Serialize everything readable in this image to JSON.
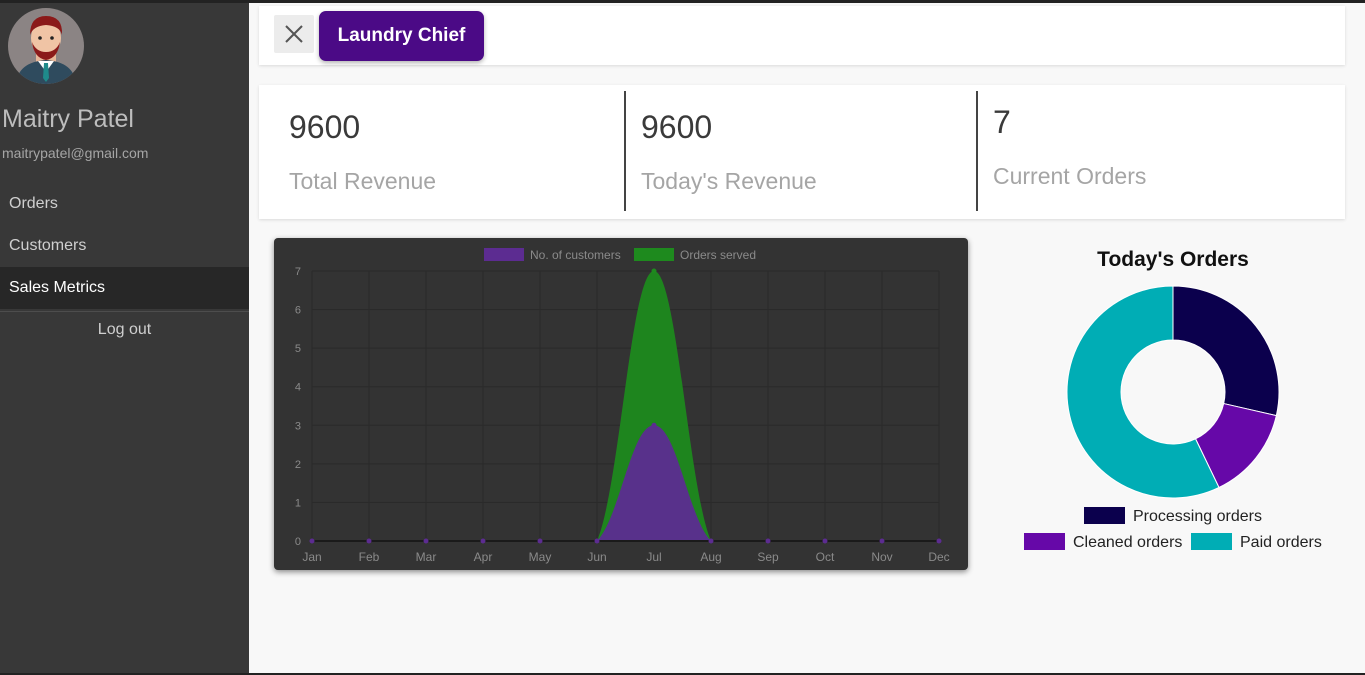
{
  "user": {
    "name": "Maitry Patel",
    "email": "maitrypatel@gmail.com"
  },
  "sidebar": {
    "items": [
      {
        "label": "Orders"
      },
      {
        "label": "Customers"
      },
      {
        "label": "Sales Metrics"
      }
    ],
    "logout_label": "Log out"
  },
  "topbar": {
    "brand_label": "Laundry Chief",
    "close_icon": "close-icon"
  },
  "stats": [
    {
      "value": "9600",
      "label": "Total Revenue"
    },
    {
      "value": "9600",
      "label": "Today's Revenue"
    },
    {
      "value": "7",
      "label": "Current Orders"
    }
  ],
  "colors": {
    "brand": "#4b0a86",
    "customers": "#5c2c91",
    "orders": "#1e8a1e",
    "processing": "#0b004d",
    "cleaned": "#6608a8",
    "paid": "#00adb5"
  },
  "chart_data": [
    {
      "type": "area",
      "categories": [
        "Jan",
        "Feb",
        "Mar",
        "Apr",
        "May",
        "Jun",
        "Jul",
        "Aug",
        "Sep",
        "Oct",
        "Nov",
        "Dec"
      ],
      "series": [
        {
          "name": "No. of customers",
          "values": [
            0,
            0,
            0,
            0,
            0,
            0,
            3,
            0,
            0,
            0,
            0,
            0
          ]
        },
        {
          "name": "Orders served",
          "values": [
            0,
            0,
            0,
            0,
            0,
            0,
            7,
            0,
            0,
            0,
            0,
            0
          ]
        }
      ],
      "yticks": [
        "0",
        "1",
        "2",
        "3",
        "4",
        "5",
        "6",
        "7"
      ],
      "ylim": [
        0,
        7
      ],
      "legend": "top",
      "grid": true
    },
    {
      "type": "pie",
      "title": "Today's Orders",
      "labels": [
        "Processing orders",
        "Cleaned orders",
        "Paid orders"
      ],
      "values": [
        2,
        1,
        4
      ],
      "legend": "bottom"
    }
  ]
}
